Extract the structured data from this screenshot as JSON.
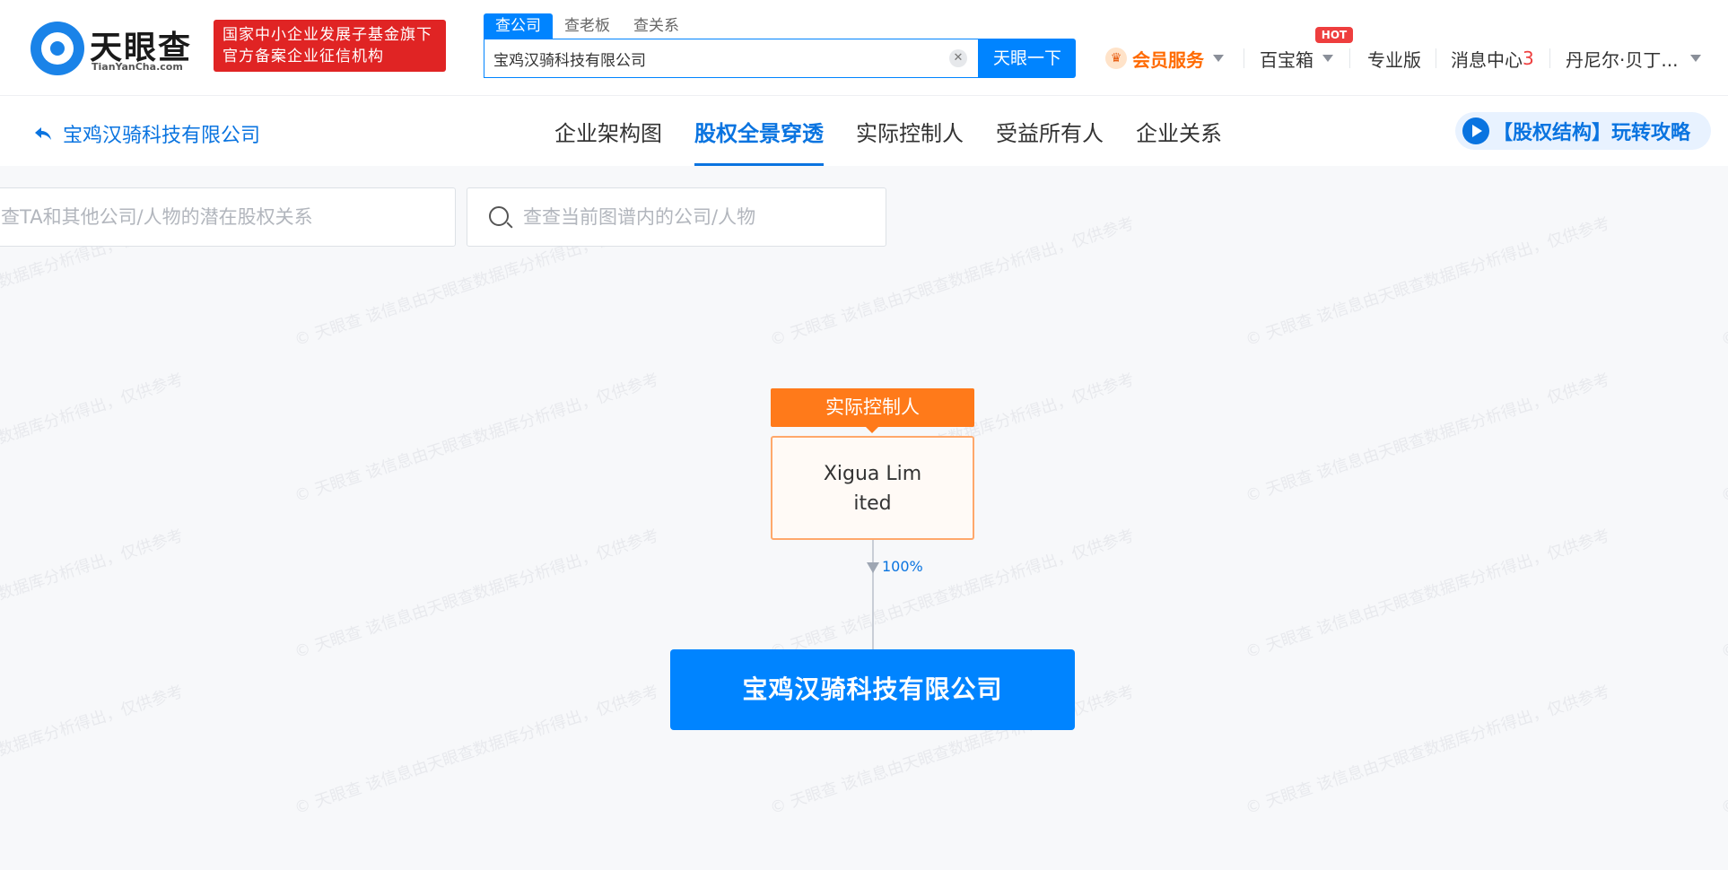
{
  "header": {
    "logo_name": "天眼查",
    "logo_sub": "TianYanCha.com",
    "badge_line1": "国家中小企业发展子基金旗下",
    "badge_line2": "官方备案企业征信机构",
    "search_tabs": [
      "查公司",
      "查老板",
      "查关系"
    ],
    "search_value": "宝鸡汉骑科技有限公司",
    "search_button": "天眼一下",
    "nav": {
      "vip": "会员服务",
      "treasure": "百宝箱",
      "hot": "HOT",
      "pro": "专业版",
      "messages": "消息中心",
      "message_count": "3",
      "user": "丹尼尔·贝丁..."
    }
  },
  "subnav": {
    "back_label": "宝鸡汉骑科技有限公司",
    "tabs": [
      "企业架构图",
      "股权全景穿透",
      "实际控制人",
      "受益所有人",
      "企业关系"
    ],
    "active_tab": 1,
    "guide": "【股权结构】玩转攻略"
  },
  "filters": {
    "left_placeholder": "查TA和其他公司/人物的潜在股权关系",
    "right_placeholder": "查查当前图谱内的公司/人物"
  },
  "watermark": {
    "brand": "天眼查",
    "text": "该信息由天眼查数据库分析得出，仅供参考"
  },
  "graph": {
    "controller_tag": "实际控制人",
    "holder_name": "Xigua Limited",
    "share": "100%",
    "company_name": "宝鸡汉骑科技有限公司"
  },
  "colors": {
    "primary": "#0084ff",
    "controller": "#ff7a1a",
    "badge_red": "#e02424",
    "vip": "#ff6a00"
  }
}
